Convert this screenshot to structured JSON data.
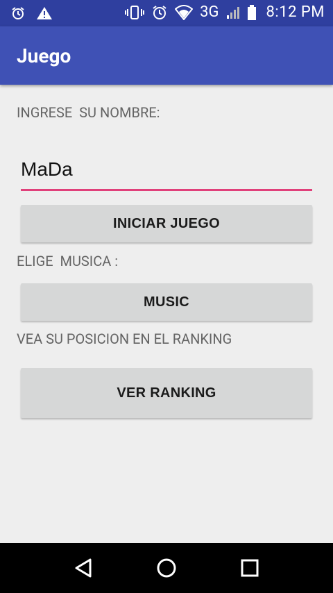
{
  "status_bar": {
    "time": "8:12 PM",
    "network": "3G",
    "icons": [
      "alarm-icon",
      "warning-icon",
      "vibrate-icon",
      "alarm-icon",
      "wifi-icon",
      "signal-icon",
      "battery-icon"
    ]
  },
  "app_bar": {
    "title": "Juego",
    "color": "#3f51b5"
  },
  "form": {
    "name_label": "INGRESE  SU NOMBRE:",
    "name_value": "MaDa",
    "start_button": "INICIAR JUEGO",
    "music_label": "ELIGE  MUSICA :",
    "music_button": "MUSIC",
    "ranking_label": "VEA SU POSICION EN EL RANKING",
    "ranking_button": "VER RANKING",
    "accent_color": "#e0407a"
  },
  "nav_bar": {
    "icons": [
      "back-icon",
      "home-icon",
      "recents-icon"
    ]
  }
}
